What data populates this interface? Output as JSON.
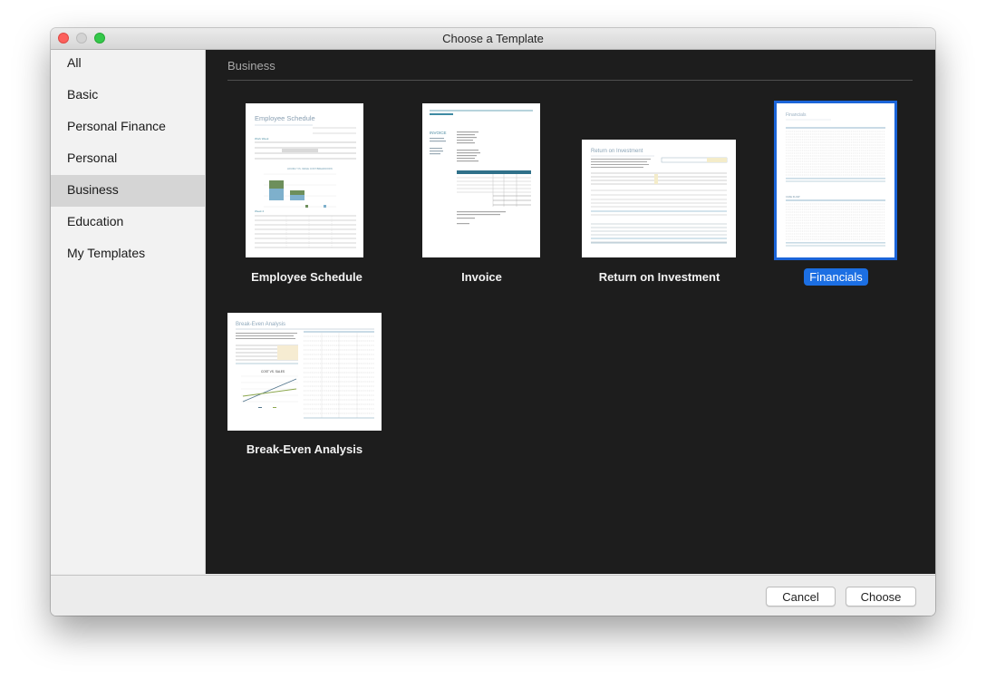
{
  "window": {
    "title": "Choose a Template"
  },
  "sidebar": {
    "items": [
      {
        "label": "All"
      },
      {
        "label": "Basic"
      },
      {
        "label": "Personal Finance"
      },
      {
        "label": "Personal"
      },
      {
        "label": "Business"
      },
      {
        "label": "Education"
      },
      {
        "label": "My Templates"
      }
    ],
    "selected": "Business"
  },
  "content": {
    "section_title": "Business",
    "templates": [
      {
        "label": "Employee Schedule",
        "thumb_title": "Employee Schedule"
      },
      {
        "label": "Invoice",
        "thumb_title": "INVOICE"
      },
      {
        "label": "Return on Investment",
        "thumb_title": "Return on Investment"
      },
      {
        "label": "Financials",
        "thumb_title": "Financials",
        "selected": true
      },
      {
        "label": "Break-Even Analysis",
        "thumb_title": "Break-Even Analysis"
      }
    ]
  },
  "footer": {
    "cancel_label": "Cancel",
    "choose_label": "Choose"
  },
  "colors": {
    "content_bg": "#1d1d1d",
    "selection_blue": "#1c6fe3",
    "sidebar_selected": "#d5d5d5",
    "close_red": "#fc605c",
    "maximize_green": "#34c84a"
  }
}
